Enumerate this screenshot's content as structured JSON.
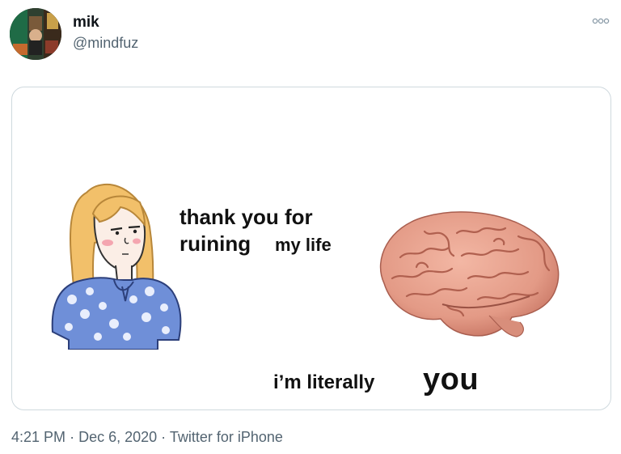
{
  "author": {
    "display_name": "mik",
    "handle": "@mindfuz"
  },
  "more_icon": "more-dots-icon",
  "meme": {
    "top_line_1": "thank you for",
    "top_line_2_bold": "ruining",
    "top_line_2_rest": "my life",
    "bottom_normal": "i’m literally",
    "bottom_bold": "you"
  },
  "meta": {
    "time": "4:21 PM",
    "separator": "·",
    "date": "Dec 6, 2020",
    "client": "Twitter for iPhone"
  },
  "colors": {
    "text_primary": "#0f1419",
    "text_secondary": "#536471",
    "card_border": "#cfd9de",
    "brain_pink": "#e6a08c"
  }
}
